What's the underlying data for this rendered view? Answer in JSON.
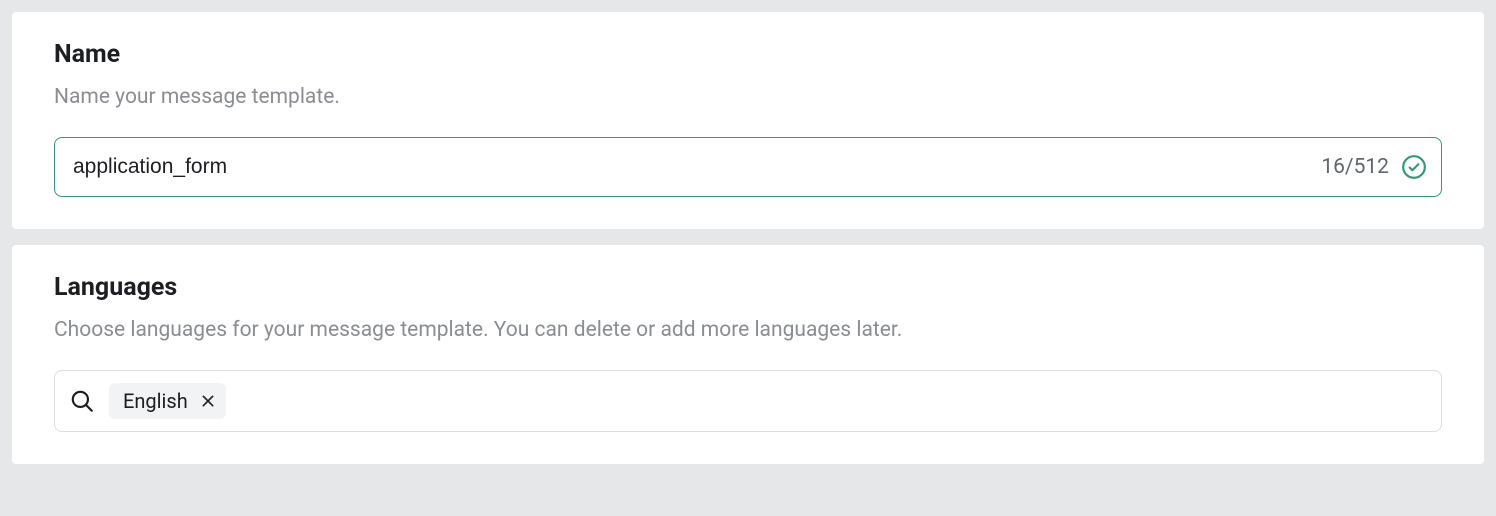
{
  "name_section": {
    "title": "Name",
    "subtitle": "Name your message template.",
    "value": "application_form",
    "counter": "16/512"
  },
  "languages_section": {
    "title": "Languages",
    "subtitle": "Choose languages for your message template. You can delete or add more languages later.",
    "chips": [
      {
        "label": "English"
      }
    ]
  }
}
